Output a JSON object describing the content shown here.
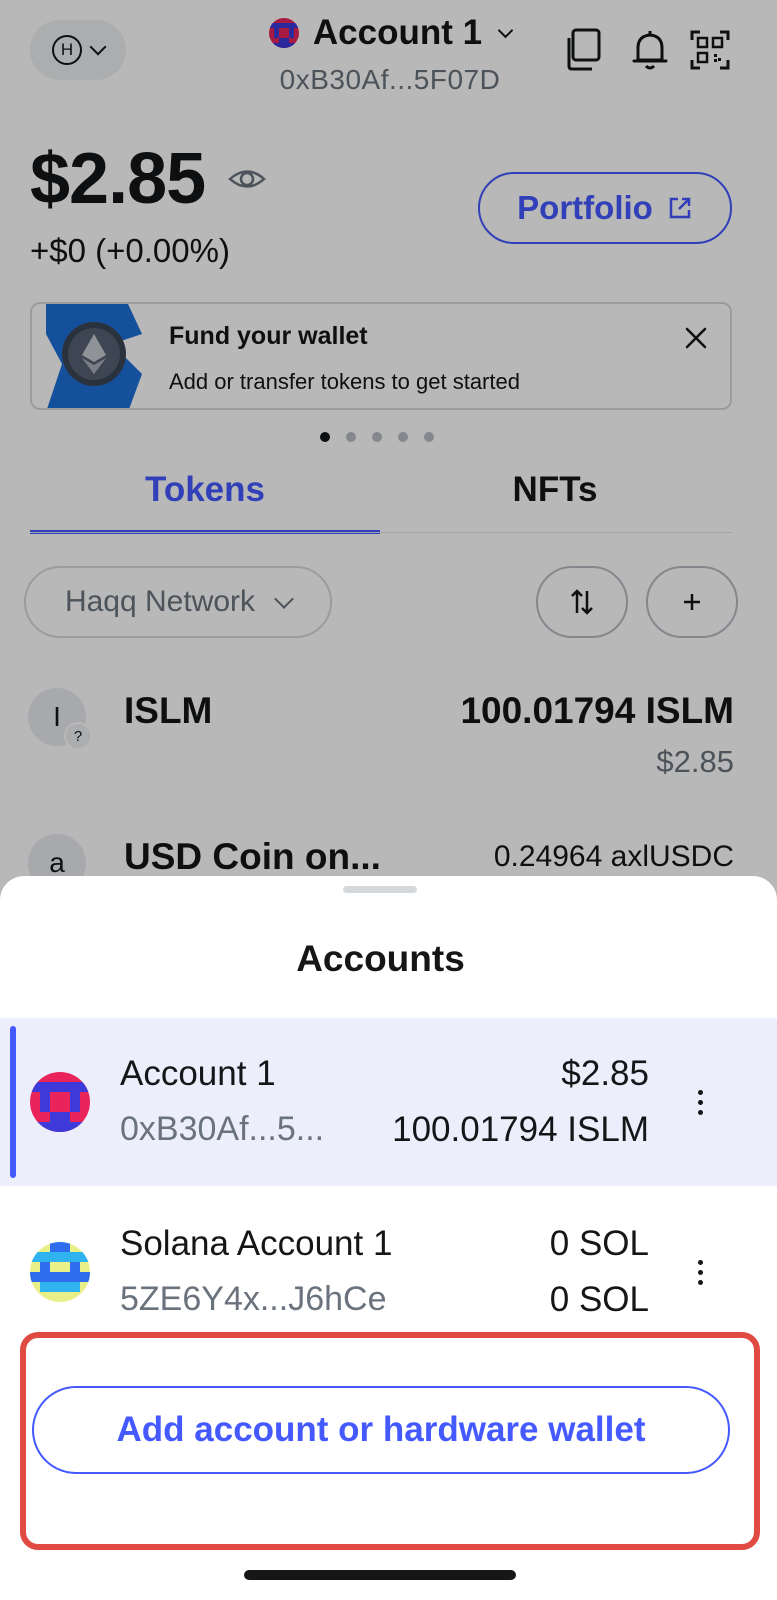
{
  "header": {
    "network_letter": "H",
    "account_name": "Account 1",
    "account_address": "0xB30Af...5F07D"
  },
  "balance": {
    "amount": "$2.85",
    "change": "+$0 (+0.00%)",
    "portfolio_label": "Portfolio"
  },
  "banner": {
    "title": "Fund your wallet",
    "subtitle": "Add or transfer tokens to get started",
    "pages": 5,
    "active_page": 1
  },
  "tabs": [
    {
      "label": "Tokens",
      "active": true
    },
    {
      "label": "NFTs",
      "active": false
    }
  ],
  "filter": {
    "network": "Haqq Network"
  },
  "tokens": [
    {
      "avatar": "I",
      "name": "ISLM",
      "amount": "100.01794 ISLM",
      "fiat": "$2.85",
      "badge": "?"
    },
    {
      "avatar": "a",
      "name": "USD Coin on...",
      "amount": "0.24964 axlUSDC",
      "fiat": ""
    }
  ],
  "sheet": {
    "title": "Accounts",
    "accounts": [
      {
        "name": "Account 1",
        "address": "0xB30Af...5...",
        "value1": "$2.85",
        "value2": "100.01794 ISLM",
        "selected": true
      },
      {
        "name": "Solana Account 1",
        "address": "5ZE6Y4x...J6hCe",
        "value1": "0 SOL",
        "value2": "0 SOL",
        "selected": false
      }
    ],
    "add_button_label": "Add account or hardware wallet"
  },
  "colors": {
    "accent": "#4459ff",
    "highlight": "#e04a43",
    "selected_row": "#eceefc"
  }
}
